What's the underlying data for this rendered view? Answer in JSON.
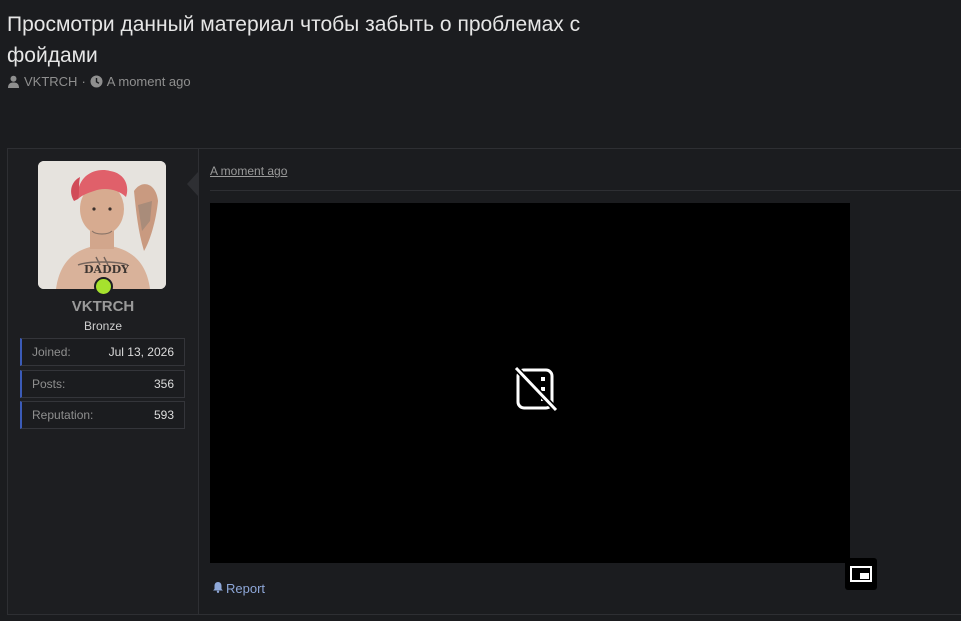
{
  "thread": {
    "title": "Просмотри данный материал чтобы забыть о проблемах с фойдами",
    "author": "VKTRCH",
    "separator": "·",
    "time": "A moment ago"
  },
  "post": {
    "date": "A moment ago",
    "report_label": "Report"
  },
  "user": {
    "name": "VKTRCH",
    "rank": "Bronze",
    "online": true,
    "stats": [
      {
        "label": "Joined:",
        "value": "Jul 13, 2026"
      },
      {
        "label": "Posts:",
        "value": "356"
      },
      {
        "label": "Reputation:",
        "value": "593"
      }
    ]
  },
  "icons": {
    "author": "user-icon",
    "time": "clock-icon",
    "report": "bell-icon",
    "video_placeholder": "no-media-icon",
    "pip": "picture-in-picture-icon"
  },
  "colors": {
    "background": "#1b1c1f",
    "online": "#a6e22e",
    "accent": "#3b5bb8",
    "link": "#8ea7d8"
  }
}
